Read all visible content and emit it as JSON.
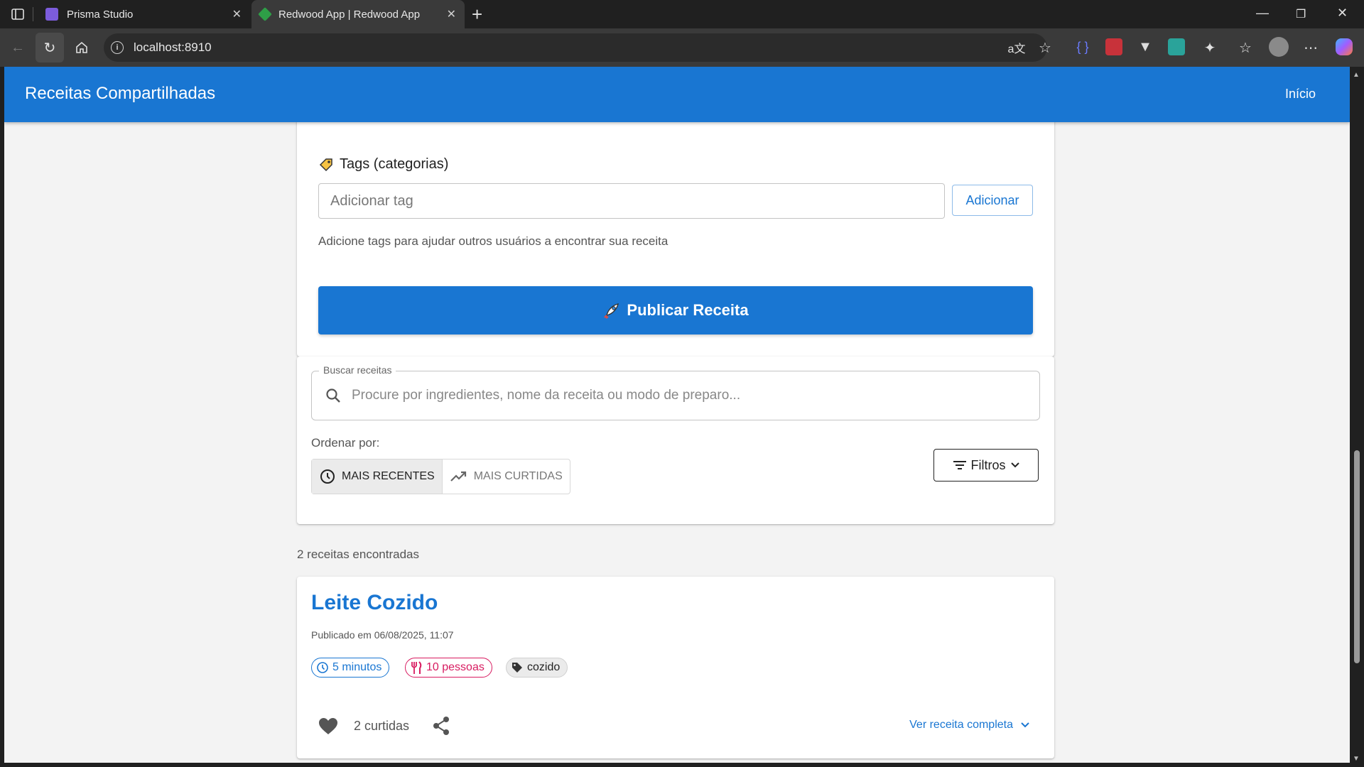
{
  "browser": {
    "tabs": [
      {
        "title": "Prisma Studio"
      },
      {
        "title": "Redwood App | Redwood App"
      }
    ],
    "address": "localhost:8910"
  },
  "app": {
    "title": "Receitas Compartilhadas",
    "nav_home": "Início"
  },
  "form": {
    "tags_label": "Tags (categorias)",
    "tag_input_placeholder": "Adicionar tag",
    "add_button": "Adicionar",
    "helper": "Adicione tags para ajudar outros usuários a encontrar sua receita",
    "publish_button": "Publicar Receita"
  },
  "search": {
    "legend": "Buscar receitas",
    "placeholder": "Procure por ingredientes, nome da receita ou modo de preparo...",
    "sort_label": "Ordenar por:",
    "sort_options": [
      "MAIS RECENTES",
      "MAIS CURTIDAS"
    ],
    "filters_button": "Filtros"
  },
  "results": {
    "count_text": "2 receitas encontradas"
  },
  "recipe": {
    "title": "Leite Cozido",
    "published": "Publicado em 06/08/2025, 11:07",
    "time": "5 minutos",
    "servings": "10 pessoas",
    "tag": "cozido",
    "likes": "2 curtidas",
    "view_full": "Ver receita completa"
  },
  "colors": {
    "primary": "#1976d2",
    "servings_chip": "#d81b60",
    "page_bg": "#f3f3f3"
  }
}
